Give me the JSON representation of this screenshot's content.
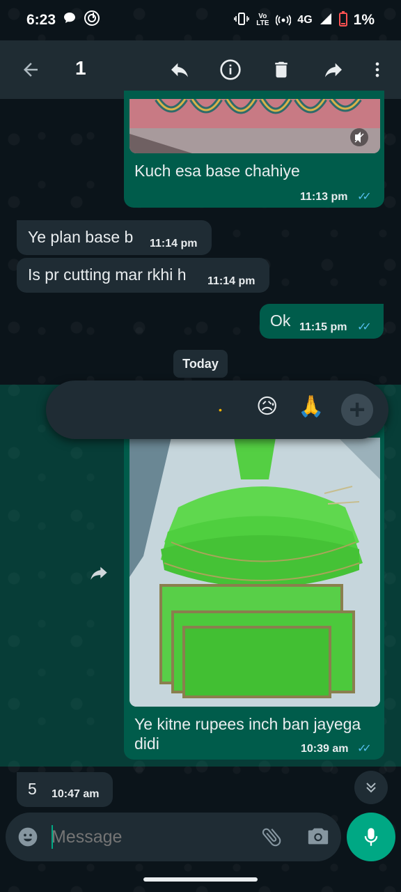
{
  "status_bar": {
    "time": "6:23",
    "network": "4G",
    "volte": "Vo LTE",
    "battery": "1%"
  },
  "action_bar": {
    "selected_count": "1",
    "icons": [
      "back-arrow-icon",
      "reply-icon",
      "info-icon",
      "delete-icon",
      "forward-icon",
      "more-vert-icon"
    ]
  },
  "messages": [
    {
      "id": "m1",
      "direction": "out",
      "type": "image",
      "text": "Kuch esa base chahiye",
      "time": "11:13 pm",
      "read": true
    },
    {
      "id": "m2",
      "direction": "in",
      "text": "Ye plan base b",
      "time": "11:14 pm"
    },
    {
      "id": "m3",
      "direction": "in",
      "text": "Is pr cutting mar rkhi h",
      "time": "11:14 pm"
    },
    {
      "id": "m4",
      "direction": "out",
      "text": "Ok",
      "time": "11:15 pm",
      "read": true
    },
    {
      "id": "m5",
      "direction": "out",
      "type": "image",
      "text_line1": "Ye kitne rupees inch ban jayega",
      "text_line2": "didi",
      "time": "10:39 am",
      "read": true,
      "selected": true
    },
    {
      "id": "m6",
      "direction": "in",
      "text": "5",
      "time": "10:47 am"
    }
  ],
  "day_separator": "Today",
  "reactions": {
    "emojis": [
      "•",
      "😥",
      "🙏"
    ],
    "more": "+"
  },
  "composer": {
    "placeholder": "Message"
  },
  "colors": {
    "background": "#0b141a",
    "outgoing_bubble": "#005c4b",
    "incoming_bubble": "#1f2c34",
    "accent": "#00a884",
    "read_ticks": "#53bdeb"
  }
}
